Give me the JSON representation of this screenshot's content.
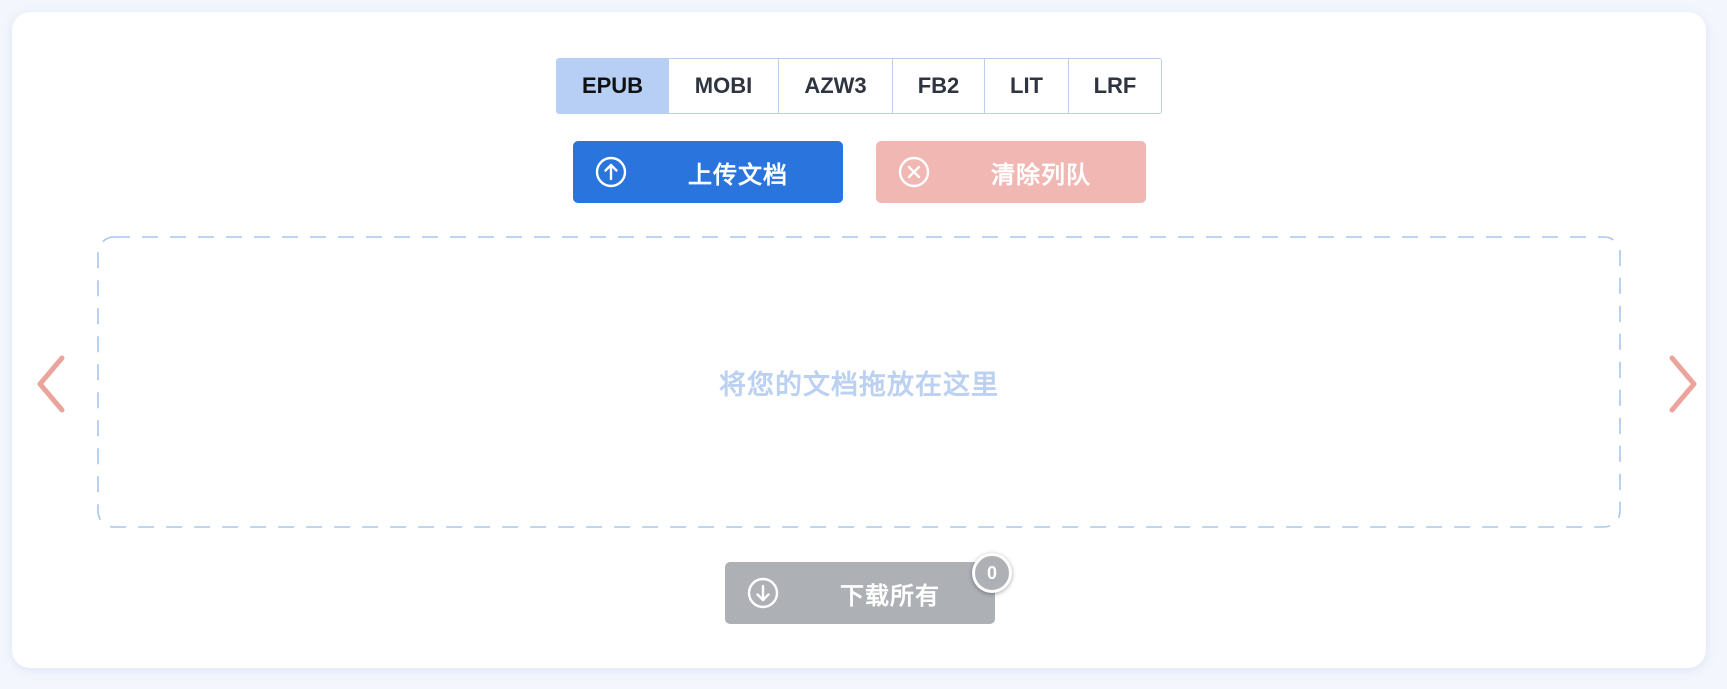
{
  "formats": {
    "tabs": [
      "EPUB",
      "MOBI",
      "AZW3",
      "FB2",
      "LIT",
      "LRF"
    ],
    "selected": "EPUB"
  },
  "actions": {
    "upload_label": "上传文档",
    "clear_label": "清除列队",
    "download_label": "下载所有",
    "download_count": "0"
  },
  "dropzone": {
    "placeholder": "将您的文档拖放在这里"
  },
  "colors": {
    "upload": "#2a74de",
    "clear": "#f0b7b3",
    "download": "#adb1b6",
    "arrows": "#eba49b",
    "tab_active": "#b7cff4"
  },
  "icons": {
    "upload": "arrow-up-circle-icon",
    "clear": "x-circle-icon",
    "download": "arrow-down-circle-icon",
    "prev": "chevron-left-icon",
    "next": "chevron-right-icon"
  }
}
